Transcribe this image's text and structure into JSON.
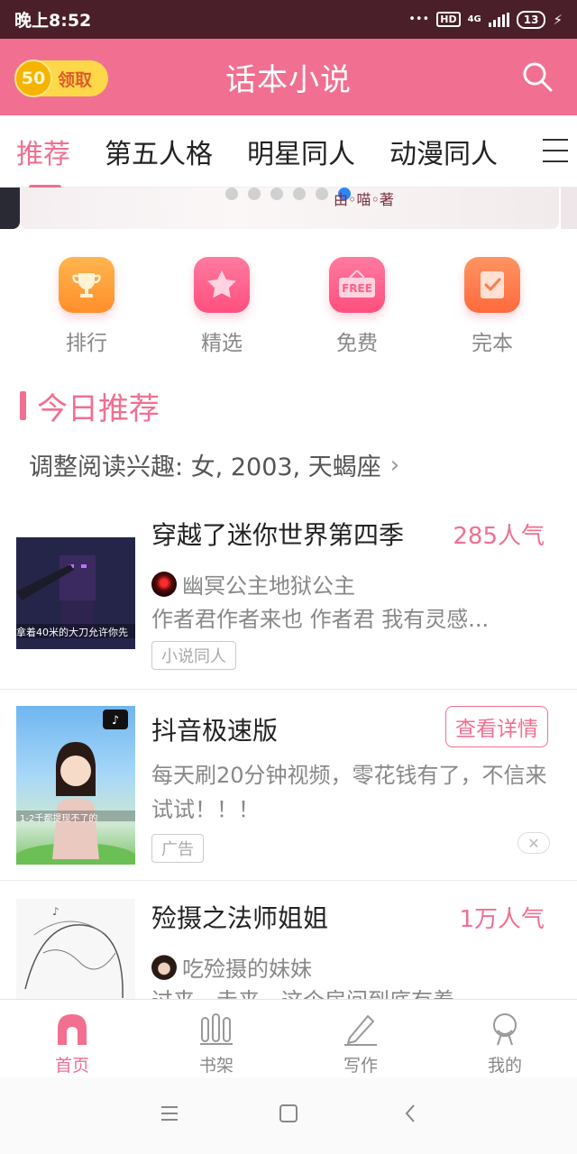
{
  "status_bar": {
    "time": "晚上8:52",
    "network": "4G",
    "hd": "HD",
    "battery": "13"
  },
  "header": {
    "coin_value": "50",
    "coin_label": "领取",
    "title": "话本小说"
  },
  "tabs": [
    {
      "label": "推荐",
      "active": true
    },
    {
      "label": "第五人格",
      "active": false
    },
    {
      "label": "明星同人",
      "active": false
    },
    {
      "label": "动漫同人",
      "active": false
    }
  ],
  "banner": {
    "author_text": "由◦喵◦著",
    "dot_count": 6,
    "active_dot": 5
  },
  "quick_links": [
    {
      "label": "排行",
      "icon": "trophy-icon",
      "color": "#ffa23a"
    },
    {
      "label": "精选",
      "icon": "star-icon",
      "color": "#ff5d8a"
    },
    {
      "label": "免费",
      "icon": "free-tag-icon",
      "color": "#ff5d8a"
    },
    {
      "label": "完本",
      "icon": "checklist-icon",
      "color": "#ff7a4a"
    }
  ],
  "section": {
    "title": "今日推荐",
    "interest_text": "调整阅读兴趣: 女, 2003, 天蝎座"
  },
  "feed": [
    {
      "title": "穿越了迷你世界第四季",
      "popularity": "285人气",
      "author": "幽冥公主地狱公主",
      "description": "作者君作者来也 作者君 我有灵感...",
      "tag": "小说同人",
      "cover_caption": "拿着40米的大刀允许你先"
    },
    {
      "title": "抖音极速版",
      "action": "查看详情",
      "description": "每天刷20分钟视频，零花钱有了，不信来试试！！！",
      "tag": "广告",
      "cover_caption": "1-2千都提现不了的"
    },
    {
      "title": "殓摄之法师姐姐",
      "popularity": "1万人气",
      "author": "吃殓摄的妹妹",
      "description": "过来，走来，这个房间到底有着"
    }
  ],
  "bottom_nav": [
    {
      "label": "首页",
      "icon": "home-icon",
      "active": true
    },
    {
      "label": "书架",
      "icon": "bookshelf-icon",
      "active": false
    },
    {
      "label": "写作",
      "icon": "pen-icon",
      "active": false
    },
    {
      "label": "我的",
      "icon": "profile-icon",
      "active": false
    }
  ],
  "colors": {
    "accent": "#f16f90",
    "status_bar": "#4a1f29"
  }
}
